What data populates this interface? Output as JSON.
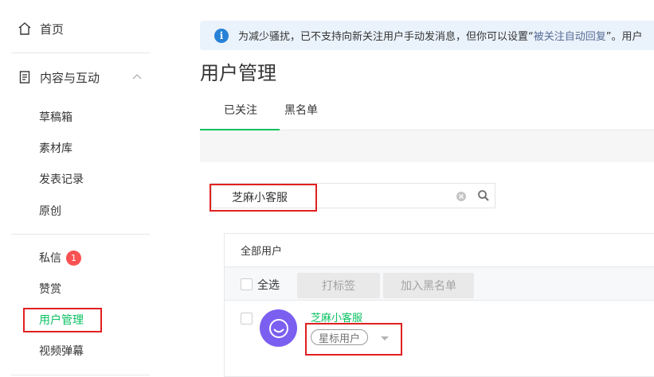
{
  "sidebar": {
    "home": "首页",
    "section": "内容与互动",
    "items": [
      "草稿箱",
      "素材库",
      "发表记录",
      "原创"
    ],
    "messages": "私信",
    "messages_badge": "1",
    "likes": "赞赏",
    "user_manage": "用户管理",
    "video_danmaku": "视频弹幕"
  },
  "notice": {
    "prefix": "为减少骚扰，已不支持向新关注用户手动发消息，但你可以设置“",
    "link": "被关注自动回复",
    "suffix": "”。用户"
  },
  "page_title": "用户管理",
  "tabs": [
    "已关注",
    "黑名单"
  ],
  "search": {
    "value": "芝麻小客服"
  },
  "panel": {
    "header": "全部用户",
    "select_all": "全选",
    "tag_button": "打标签",
    "blacklist_button": "加入黑名单"
  },
  "user": {
    "name": "芝麻小客服",
    "tag": "星标用户"
  },
  "colors": {
    "accent": "#07c160",
    "badge": "#fa5151",
    "highlight_box": "#e02020",
    "info": "#2782d7",
    "avatar": "#7b5ff0"
  }
}
